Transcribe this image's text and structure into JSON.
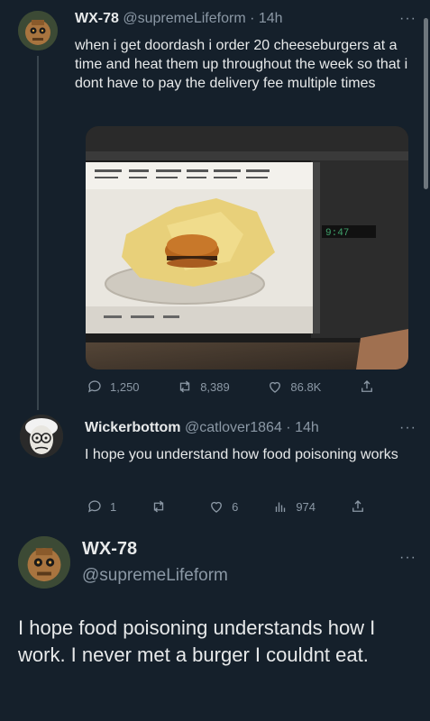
{
  "tweets": [
    {
      "name": "WX-78",
      "handle": "@supremeLifeform",
      "time": "· 14h",
      "text": "when i get doordash i order 20 cheeseburgers at a time and heat them up throughout the week so that i dont have to pay the delivery fee multiple times",
      "replies": "1,250",
      "retweets": "8,389",
      "likes": "86.8K",
      "microwave_display": "9:47"
    },
    {
      "name": "Wickerbottom",
      "handle": "@catlover1864",
      "time": "· 14h",
      "text": "I hope you understand how food poisoning works",
      "replies": "1",
      "retweets": "",
      "likes": "6",
      "views": "974"
    },
    {
      "name": "WX-78",
      "handle": "@supremeLifeform",
      "text": "I hope food poisoning understands how I work. I never met a burger I couldnt eat."
    }
  ],
  "more_glyph": "···",
  "colors": {
    "background": "#15202b",
    "text": "#e7e9ea",
    "muted": "#8b98a5",
    "divider": "#38444d"
  }
}
